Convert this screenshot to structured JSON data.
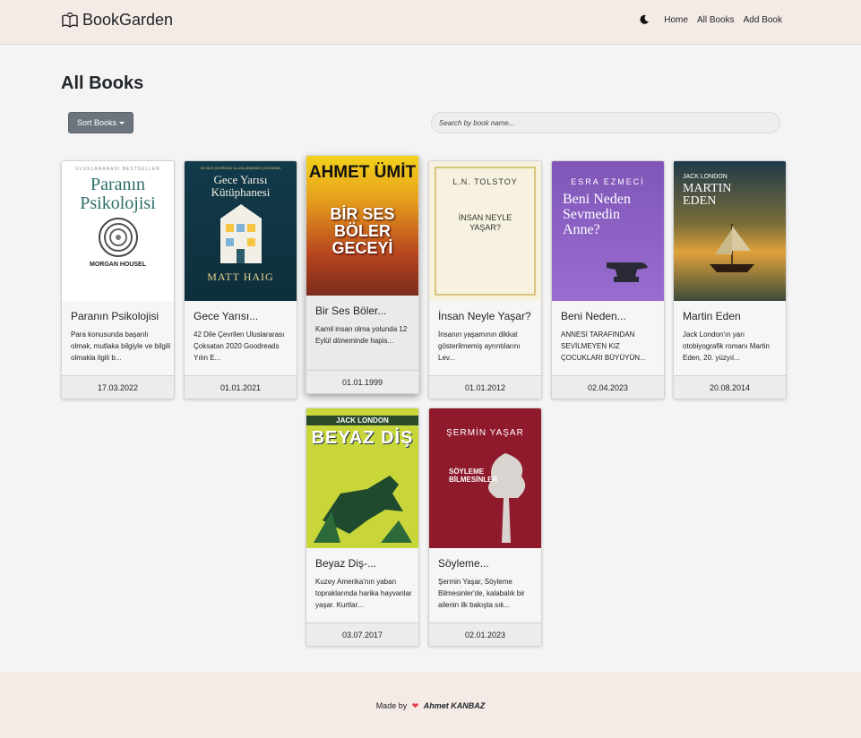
{
  "navbar": {
    "brand": "BookGarden",
    "links": {
      "home": "Home",
      "all_books": "All Books",
      "add_book": "Add Book"
    }
  },
  "page": {
    "title": "All Books",
    "sort_label": "Sort Books",
    "search_placeholder": "Search by book name..."
  },
  "books": [
    {
      "title": "Paranın Psikolojisi",
      "desc": "Para konusunda başarılı olmak, mutlaka bilgiyle ve bilgili olmakla ilgili b...",
      "date": "17.03.2022",
      "cover": {
        "top_text": "ULUSLARARASI BESTSELLER",
        "main": "Paranın Psikolojisi",
        "author": "MORGAN HOUSEL"
      }
    },
    {
      "title": "Gece Yarısı...",
      "desc": "42 Dile Çevrilen Uluslararası Çoksatan 2020 Goodreads Yılın E...",
      "date": "01.01.2021",
      "cover": {
        "top_text": "42 DİLE ÇEVRİLEN ULUSLARARASI ÇOKSATAN",
        "main": "Gece Yarısı Kütüphanesi",
        "author": "MATT HAIG"
      }
    },
    {
      "title": "Bir Ses Böler...",
      "desc": "Kamil insan olma yolunda 12 Eylül döneminde hapis...",
      "date": "01.01.1999",
      "cover": {
        "author": "AHMET ÜMİT",
        "main": "BİR SES BÖLER GECEYİ"
      }
    },
    {
      "title": "İnsan Neyle Yaşar?",
      "desc": "İnsanın yaşamının dikkat gösterilmemiş ayrıntılarını Lev...",
      "date": "01.01.2012",
      "cover": {
        "author": "L.N. TOLSTOY",
        "main": "İNSAN NEYLE YAŞAR?"
      }
    },
    {
      "title": "Beni Neden...",
      "desc": "ANNESİ TARAFINDAN SEVİLMEYEN KIZ ÇOCUKLARI BÜYÜYÜN...",
      "date": "02.04.2023",
      "cover": {
        "author": "ESRA EZMECİ",
        "main": "Beni Neden Sevmedin Anne?"
      }
    },
    {
      "title": "Martin Eden",
      "desc": "Jack London'ın yarı otobiyografik romanı Martin Eden, 20. yüzyıl...",
      "date": "20.08.2014",
      "cover": {
        "author": "JACK LONDON",
        "main": "MARTIN EDEN"
      }
    },
    {
      "title": "Beyaz Diş-...",
      "desc": "Kuzey Amerika'nın yaban topraklarında harika hayvanlar yaşar. Kurtlar...",
      "date": "03.07.2017",
      "cover": {
        "author": "JACK LONDON",
        "main": "BEYAZ DİŞ"
      }
    },
    {
      "title": "Söyleme...",
      "desc": "Şermin Yaşar, Söyleme Bilmesinler'de, kalabalık bir ailenin ilk bakışta sık...",
      "date": "02.01.2023",
      "cover": {
        "author": "ŞERMİN YAŞAR",
        "main": "SÖYLEME BİLMESİNLER"
      }
    }
  ],
  "footer": {
    "made_by": "Made by",
    "author": "Ahmet KANBAZ"
  },
  "colors": {
    "navbar_bg": "#f5ebe6",
    "button_gray": "#6c757d",
    "heart": "#e33b4a"
  }
}
